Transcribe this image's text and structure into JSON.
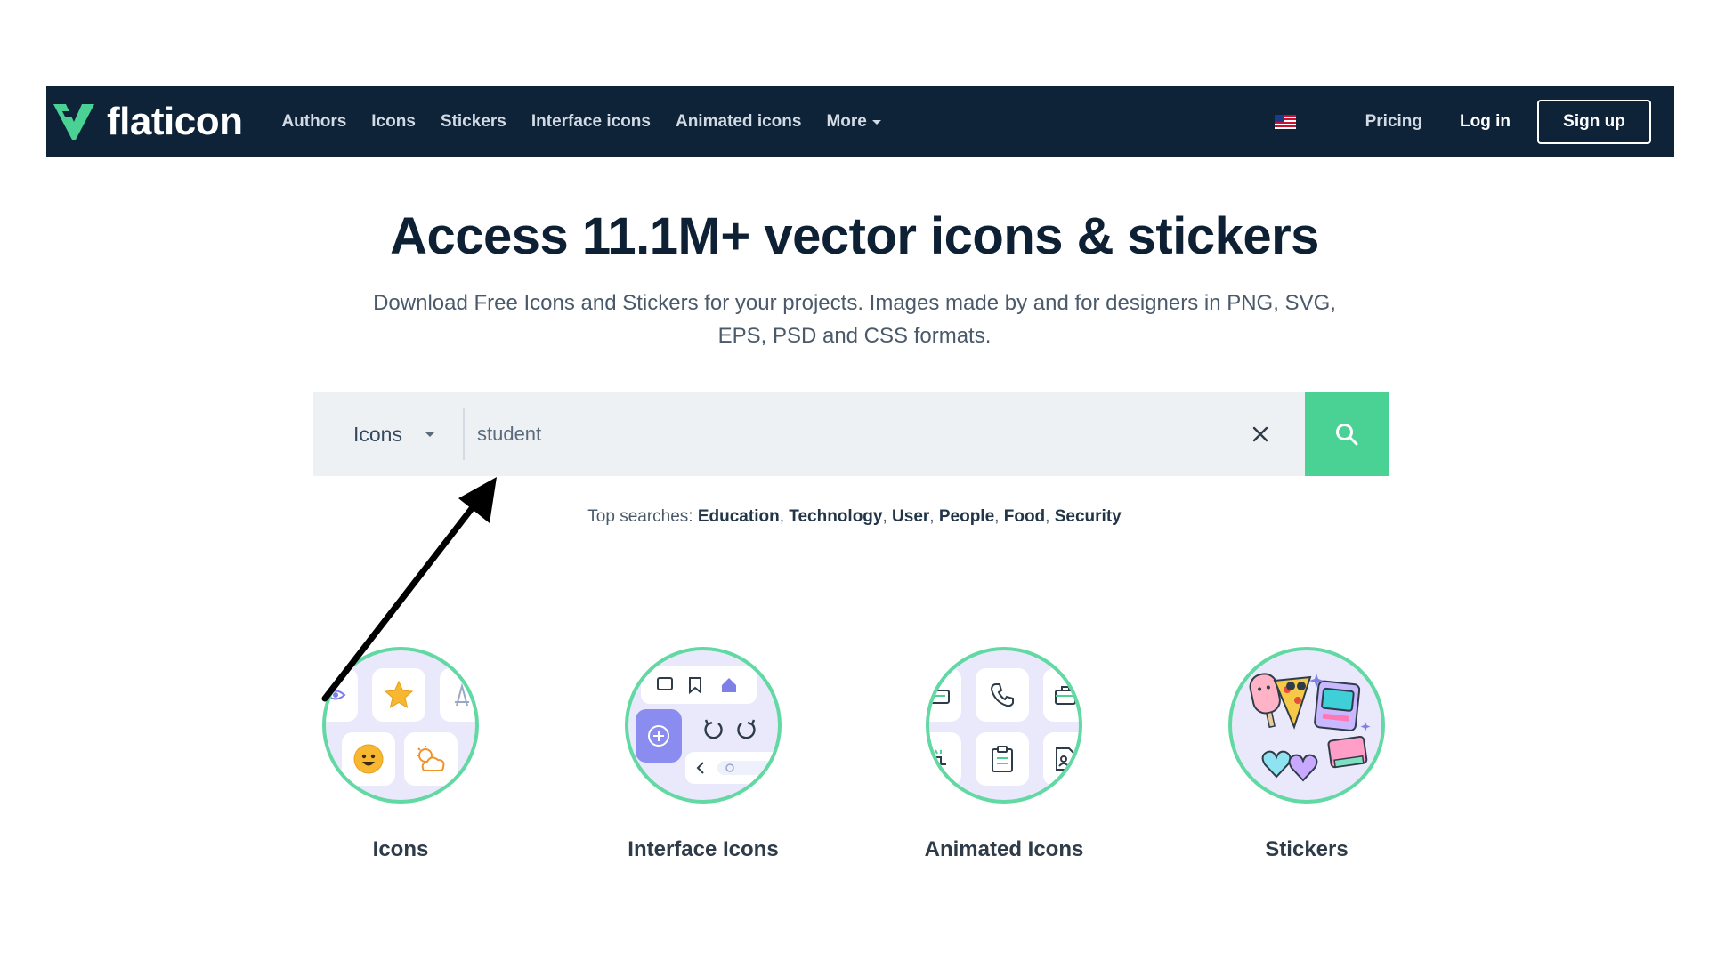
{
  "brand": {
    "name": "flaticon"
  },
  "nav": {
    "links": [
      "Authors",
      "Icons",
      "Stickers",
      "Interface icons",
      "Animated icons"
    ],
    "more_label": "More",
    "pricing_label": "Pricing",
    "login_label": "Log in",
    "signup_label": "Sign up"
  },
  "hero": {
    "title": "Access 11.1M+ vector icons & stickers",
    "subtitle": "Download Free Icons and Stickers for your projects. Images made by and for designers in PNG, SVG, EPS, PSD and CSS formats."
  },
  "search": {
    "type_label": "Icons",
    "value": "student"
  },
  "top_searches": {
    "label": "Top searches:",
    "items": [
      "Education",
      "Technology",
      "User",
      "People",
      "Food",
      "Security"
    ]
  },
  "categories": [
    {
      "label": "Icons"
    },
    {
      "label": "Interface Icons"
    },
    {
      "label": "Animated Icons"
    },
    {
      "label": "Stickers"
    }
  ],
  "colors": {
    "navbar_bg": "#0e2238",
    "accent_green": "#4ad295",
    "search_bg": "#eef1f4",
    "category_ring": "#62d8a3"
  }
}
